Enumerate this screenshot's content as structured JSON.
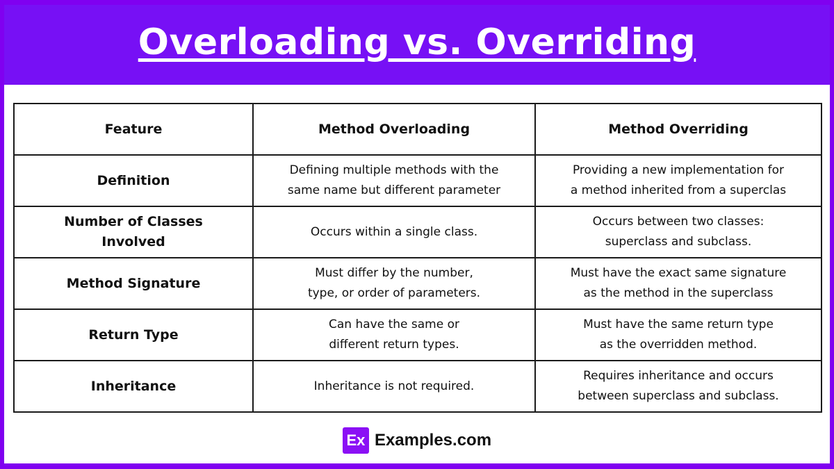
{
  "header": {
    "title": "Overloading vs. Overriding"
  },
  "table": {
    "columns": [
      "Feature",
      "Method Overloading",
      "Method Overriding"
    ],
    "rows": [
      {
        "feature": [
          "Definition"
        ],
        "overloading": [
          "Defining multiple methods with the",
          "same name but different parameter"
        ],
        "overriding": [
          "Providing a new implementation for",
          "a method inherited from a superclas"
        ]
      },
      {
        "feature": [
          "Number of Classes",
          "Involved"
        ],
        "overloading": [
          "Occurs within a single class."
        ],
        "overriding": [
          "Occurs between two classes:",
          "superclass and subclass."
        ]
      },
      {
        "feature": [
          "Method Signature"
        ],
        "overloading": [
          "Must differ by the number,",
          "type, or order of parameters."
        ],
        "overriding": [
          "Must have the exact same signature",
          "as the method in the superclass"
        ]
      },
      {
        "feature": [
          "Return Type"
        ],
        "overloading": [
          "Can have the same or",
          "different return types."
        ],
        "overriding": [
          "Must have the same return type",
          "as the overridden method."
        ]
      },
      {
        "feature": [
          "Inheritance"
        ],
        "overloading": [
          "Inheritance is not required."
        ],
        "overriding": [
          "Requires inheritance and occurs",
          "between superclass and subclass."
        ]
      }
    ]
  },
  "brand": {
    "logo_text": "Ex",
    "name": "Examples.com",
    "logo_icon": "examples-logo-icon"
  },
  "colors": {
    "frame": "#8000f0",
    "header_band": "#7710f5",
    "logo": "#8b10f5",
    "text": "#111111",
    "background": "#ffffff"
  }
}
